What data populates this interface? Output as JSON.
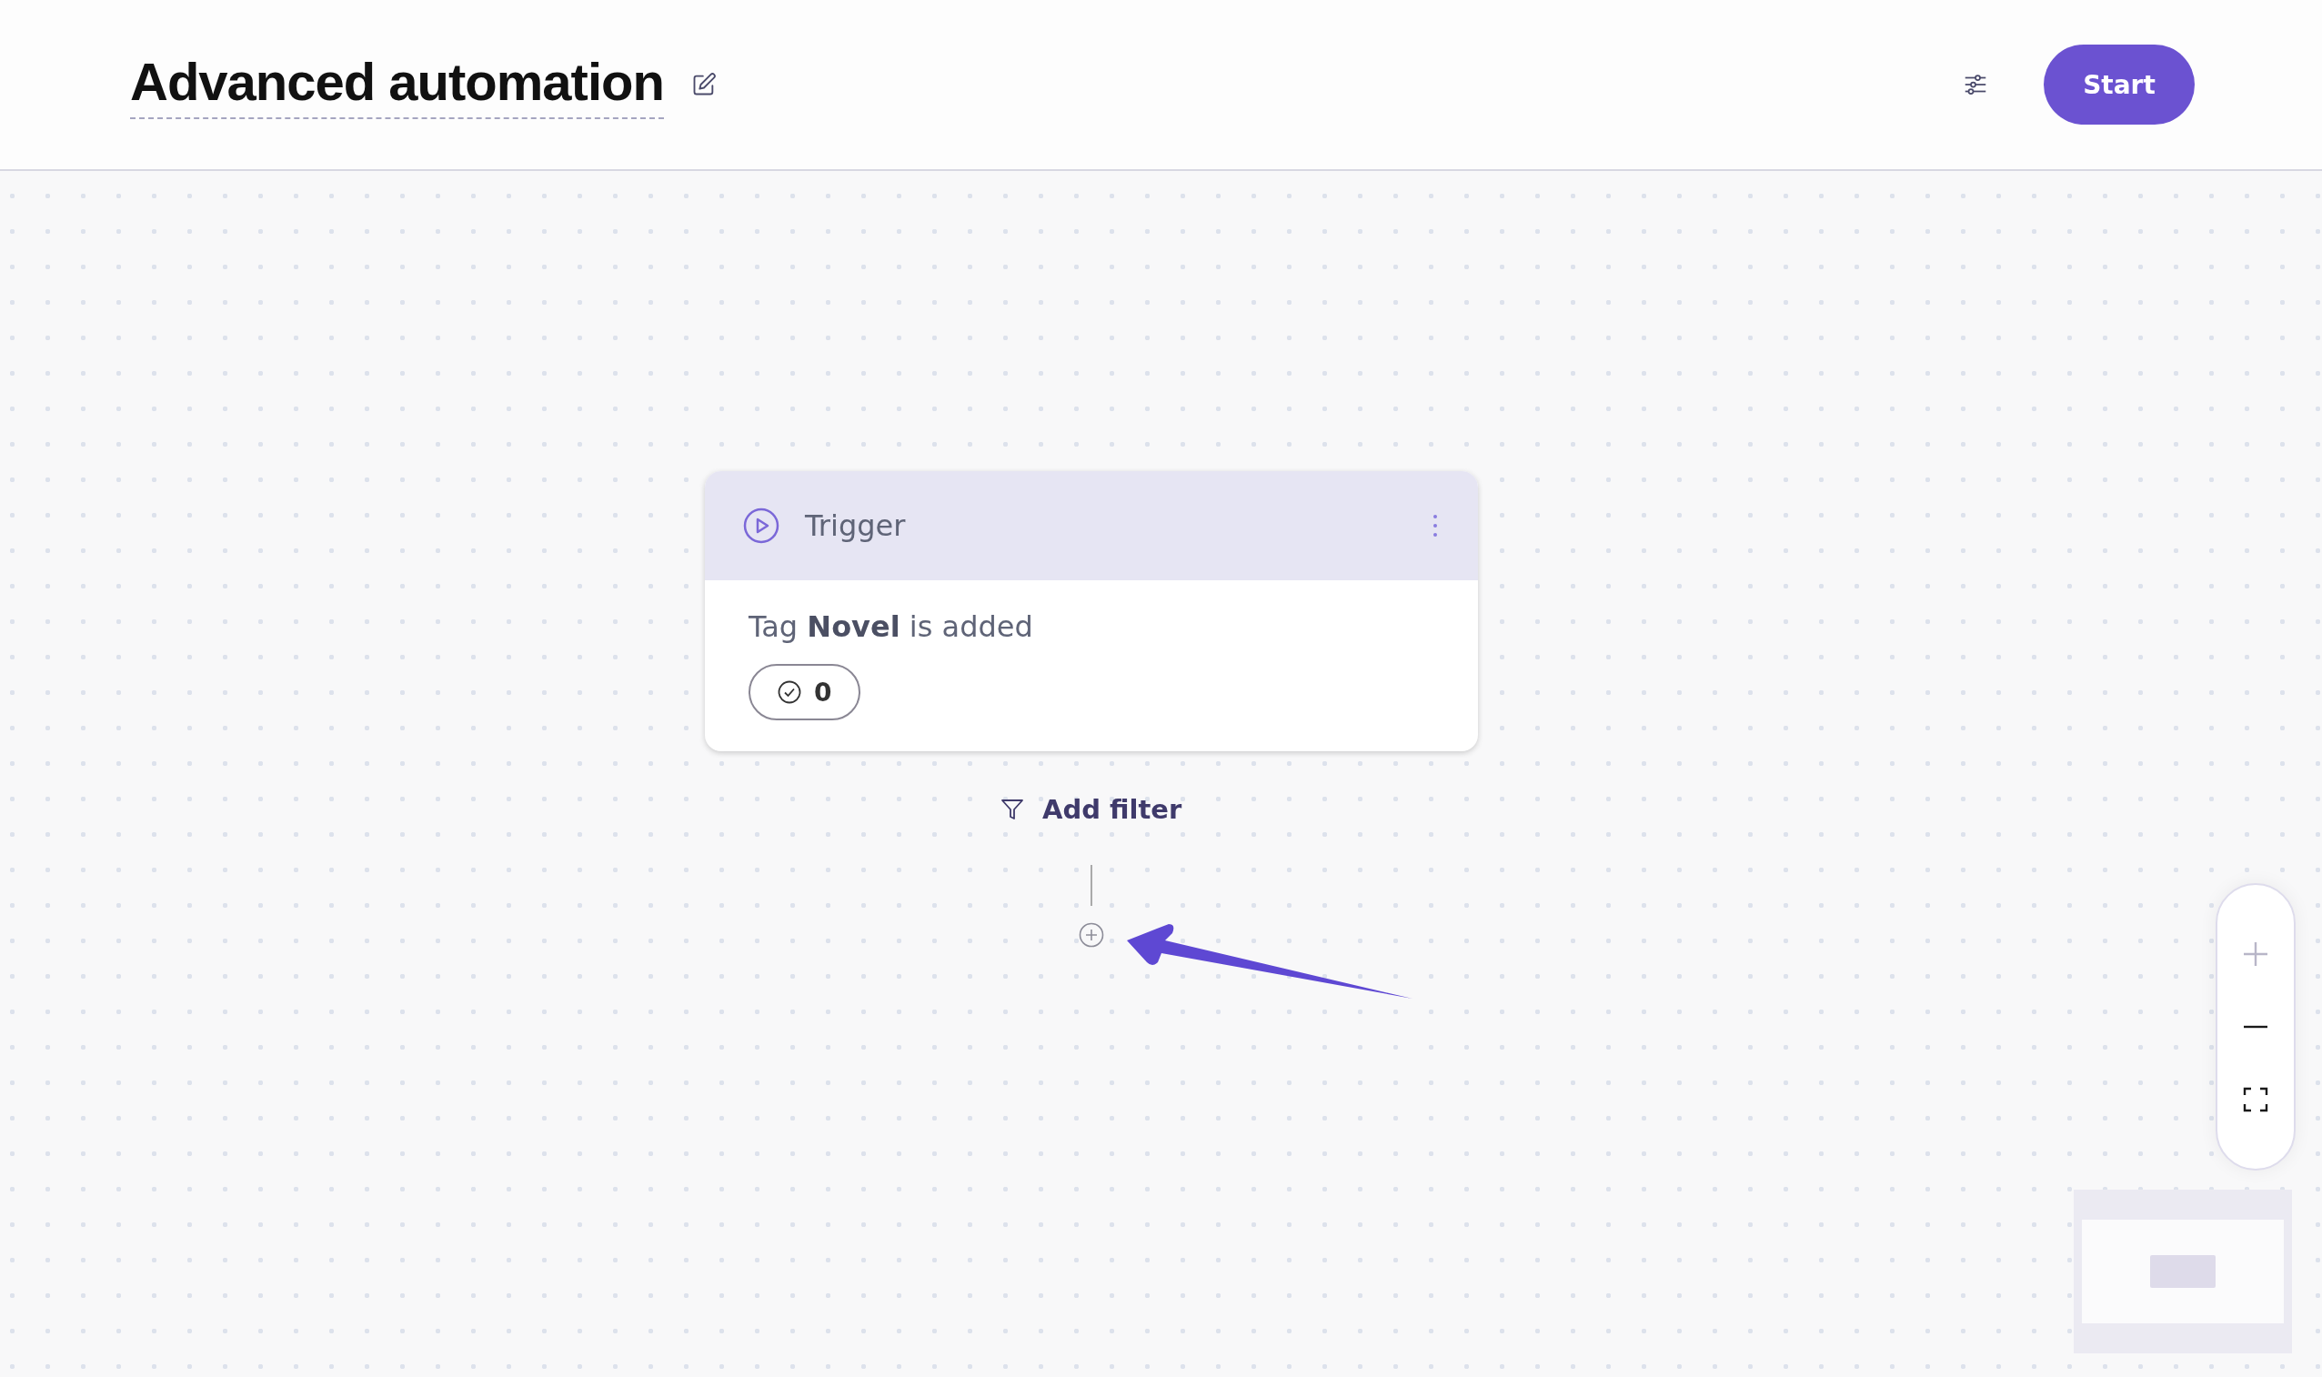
{
  "header": {
    "title": "Advanced automation",
    "start_button": "Start"
  },
  "trigger_card": {
    "title": "Trigger",
    "description": "Tag **Novel** is added",
    "count": "0"
  },
  "add_filter": "Add filter",
  "zoom_controls": [
    {
      "kind": "zoom_in",
      "disabled": true
    },
    {
      "kind": "zoom_out",
      "disabled": false
    },
    {
      "kind": "fit",
      "disabled": false
    }
  ]
}
